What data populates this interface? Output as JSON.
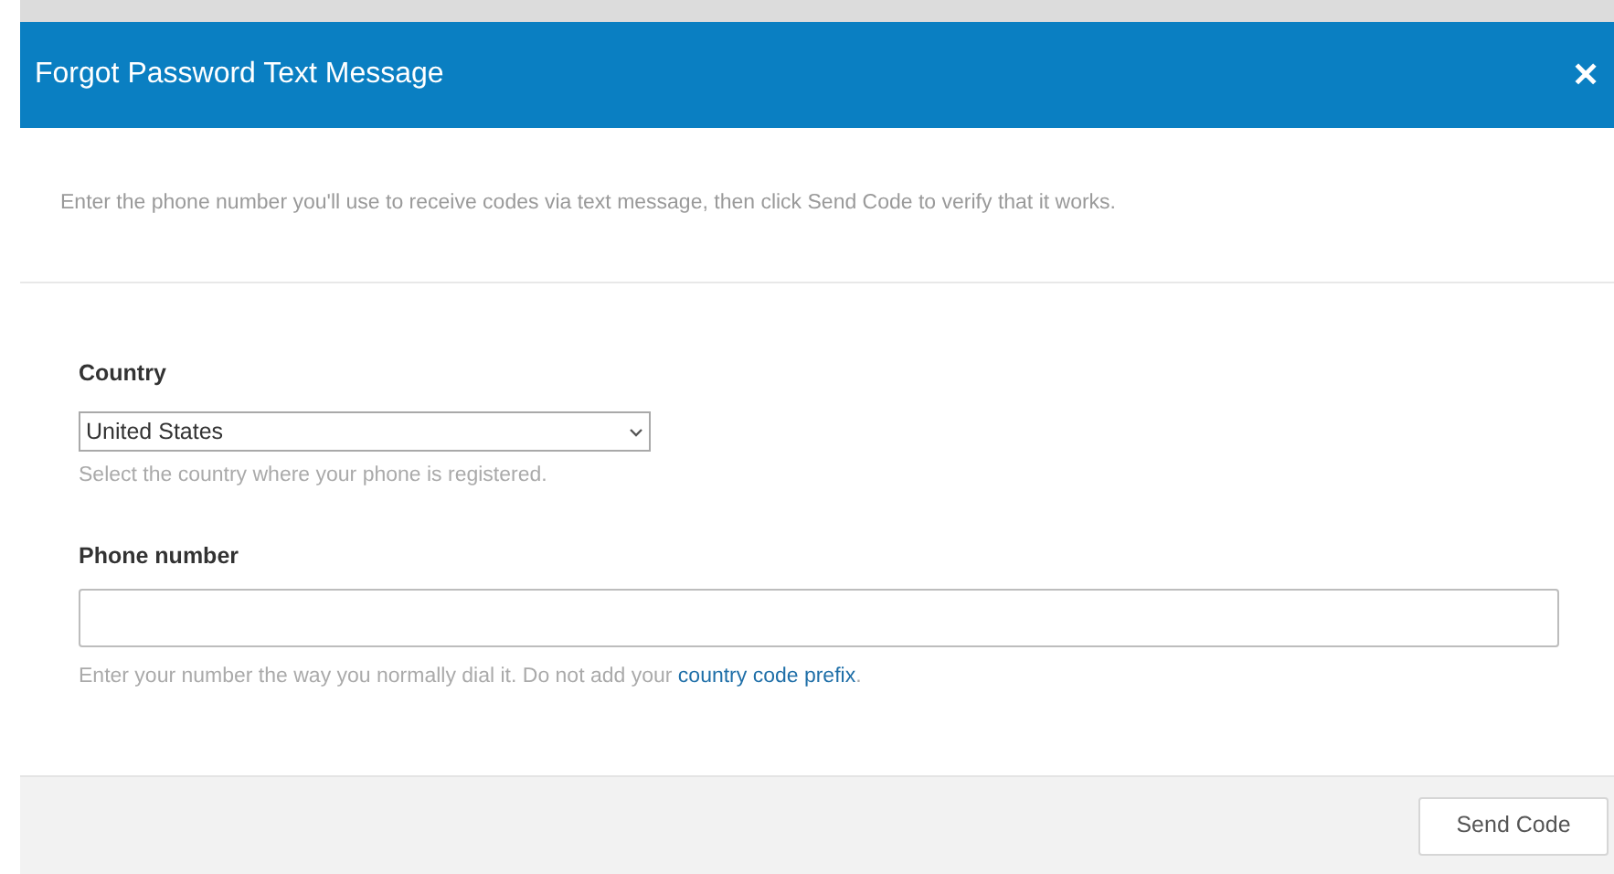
{
  "dialog": {
    "title": "Forgot Password Text Message",
    "close": "✕"
  },
  "intro": "Enter the phone number you'll use to receive codes via text message, then click Send Code to verify that it works.",
  "country": {
    "label": "Country",
    "value": "United States",
    "hint": "Select the country where your phone is registered."
  },
  "phone": {
    "label": "Phone number",
    "hint": "Enter your number the way you normally dial it. Do not add your ",
    "hint_link": "country code prefix",
    "hint_end": "."
  },
  "buttons": [
    "Send Code"
  ]
}
